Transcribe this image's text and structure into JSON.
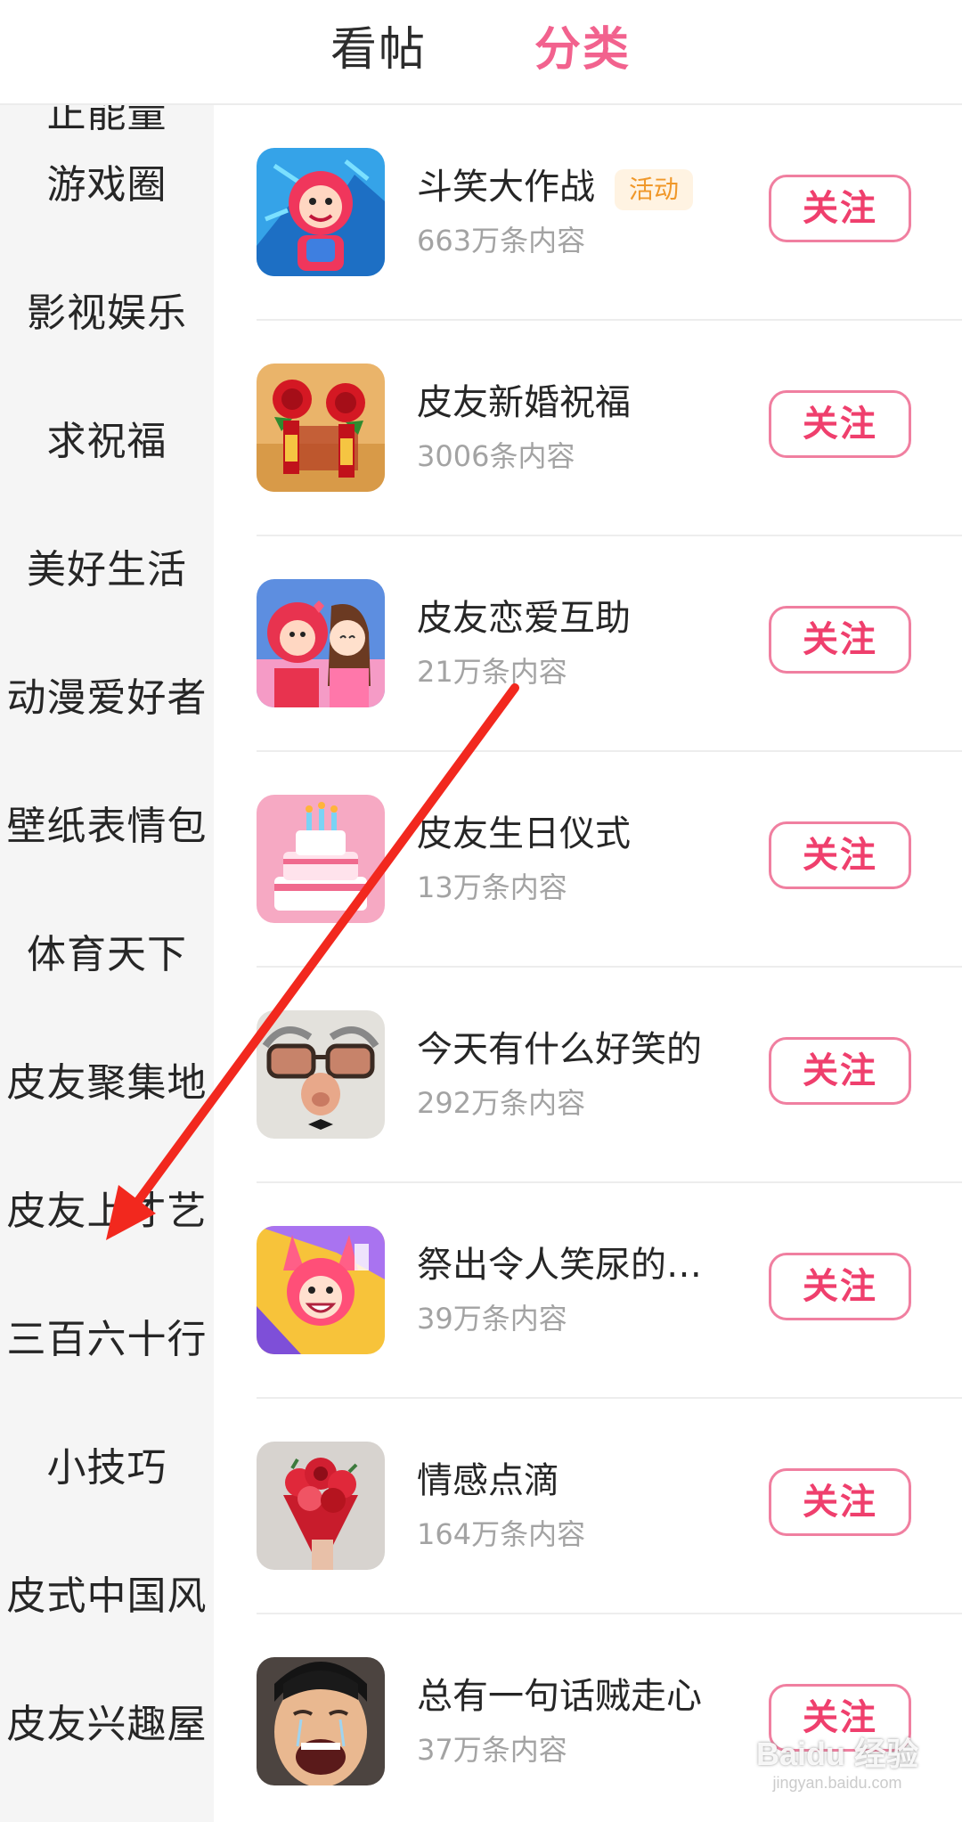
{
  "tabs": [
    {
      "label": "看帖",
      "active": false
    },
    {
      "label": "分类",
      "active": true
    }
  ],
  "sidebar": {
    "items": [
      {
        "label": "正能量"
      },
      {
        "label": "游戏圈"
      },
      {
        "label": "影视娱乐"
      },
      {
        "label": "求祝福"
      },
      {
        "label": "美好生活"
      },
      {
        "label": "动漫爱好者"
      },
      {
        "label": "壁纸表情包"
      },
      {
        "label": "体育天下"
      },
      {
        "label": "皮友聚集地"
      },
      {
        "label": "皮友上才艺"
      },
      {
        "label": "三百六十行"
      },
      {
        "label": "小技巧"
      },
      {
        "label": "皮式中国风"
      },
      {
        "label": "皮友兴趣屋"
      }
    ]
  },
  "topics": [
    {
      "name": "斗笑大作战",
      "badge": "活动",
      "count": "663万条内容",
      "follow_label": "关注",
      "icon": "cartoon-mascot-icon"
    },
    {
      "name": "皮友新婚祝福",
      "badge": "",
      "count": "3006条内容",
      "follow_label": "关注",
      "icon": "wedding-roses-icon"
    },
    {
      "name": "皮友恋爱互助",
      "badge": "",
      "count": "21万条内容",
      "follow_label": "关注",
      "icon": "couple-cartoon-icon"
    },
    {
      "name": "皮友生日仪式",
      "badge": "",
      "count": "13万条内容",
      "follow_label": "关注",
      "icon": "birthday-cake-icon"
    },
    {
      "name": "今天有什么好笑的",
      "badge": "",
      "count": "292万条内容",
      "follow_label": "关注",
      "icon": "funny-face-icon"
    },
    {
      "name": " 祭出令人笑尿的…",
      "badge": "",
      "count": "39万条内容",
      "follow_label": "关注",
      "icon": "laughing-mascot-icon"
    },
    {
      "name": "情感点滴",
      "badge": "",
      "count": "164万条内容",
      "follow_label": "关注",
      "icon": "flower-bouquet-icon"
    },
    {
      "name": "总有一句话贼走心",
      "badge": "",
      "count": "37万条内容",
      "follow_label": "关注",
      "icon": "crying-face-icon"
    }
  ],
  "watermark": {
    "main": "Baidu 经验",
    "sub": "jingyan.baidu.com"
  },
  "colors": {
    "accent": "#f2628e",
    "follow_text": "#ef3f6d",
    "follow_border": "#f07fa0",
    "badge_text": "#f0982a",
    "badge_bg": "#fff3e2",
    "sidebar_bg": "#f5f5f5",
    "annotation_arrow": "#f2281e"
  }
}
